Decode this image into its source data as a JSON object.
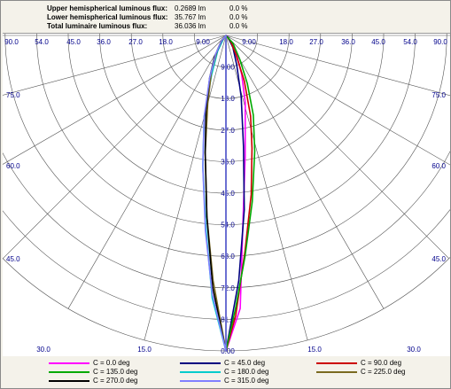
{
  "header": {
    "rows": [
      {
        "label": "Upper hemispherical luminous flux:",
        "value": "0.2689 lm",
        "pct": "0.0 %"
      },
      {
        "label": "Lower hemispherical luminous flux:",
        "value": "35.767 lm",
        "pct": "0.0 %"
      },
      {
        "label": "Total luminaire luminous flux:",
        "value": "36.036 lm",
        "pct": "0.0 %"
      }
    ]
  },
  "chart_data": {
    "type": "polar-candela",
    "title": "",
    "top_ticks": [
      "90.0",
      "54.0",
      "45.0",
      "36.0",
      "27.0",
      "18.0",
      "9.00",
      "9.00",
      "18.0",
      "27.0",
      "36.0",
      "45.0",
      "54.0",
      "90.0"
    ],
    "radial_ticks": [
      "9.00",
      "18.0",
      "27.0",
      "36.0",
      "45.0",
      "54.0",
      "63.0",
      "72.0",
      "81.0",
      "0.00"
    ],
    "angle_labels": [
      {
        "side": "left",
        "text": "75.0"
      },
      {
        "side": "left",
        "text": "60.0"
      },
      {
        "side": "left",
        "text": "45.0"
      },
      {
        "side": "right",
        "text": "75.0"
      },
      {
        "side": "right",
        "text": "60.0"
      },
      {
        "side": "right",
        "text": "45.0"
      }
    ],
    "bottom_labels": [
      {
        "side": "left",
        "text": "30.0"
      },
      {
        "side": "left",
        "text": "15.0"
      },
      {
        "side": "right",
        "text": "15.0"
      },
      {
        "side": "right",
        "text": "30.0"
      }
    ],
    "r_max": 90,
    "series": [
      {
        "name": "C = 0.0 deg",
        "color": "#ff00ff",
        "points": [
          [
            0,
            90
          ],
          [
            3,
            78
          ],
          [
            5,
            55
          ],
          [
            9,
            35
          ],
          [
            16,
            20
          ],
          [
            22,
            12
          ],
          [
            30,
            6
          ],
          [
            40,
            2
          ],
          [
            60,
            0.5
          ],
          [
            90,
            0
          ]
        ]
      },
      {
        "name": "C = 45.0 deg",
        "color": "#000080",
        "points": [
          [
            0,
            90
          ],
          [
            3,
            70
          ],
          [
            6,
            50
          ],
          [
            9,
            32
          ],
          [
            14,
            18
          ],
          [
            20,
            9
          ],
          [
            30,
            4
          ],
          [
            45,
            1
          ],
          [
            90,
            0
          ]
        ]
      },
      {
        "name": "C = 90.0 deg",
        "color": "#cc0000",
        "points": [
          [
            0,
            90
          ],
          [
            2,
            80
          ],
          [
            5,
            62
          ],
          [
            9,
            46
          ],
          [
            13,
            33
          ],
          [
            17,
            24
          ],
          [
            22,
            14
          ],
          [
            28,
            6
          ],
          [
            40,
            2
          ],
          [
            90,
            0
          ]
        ]
      },
      {
        "name": "C = 135.0 deg",
        "color": "#00aa00",
        "points": [
          [
            0,
            90
          ],
          [
            2,
            78
          ],
          [
            5,
            63
          ],
          [
            9,
            48
          ],
          [
            14,
            34
          ],
          [
            19,
            24
          ],
          [
            24,
            15
          ],
          [
            30,
            8
          ],
          [
            42,
            3
          ],
          [
            90,
            0
          ]
        ]
      },
      {
        "name": "C = 180.0 deg",
        "color": "#00cccc",
        "points": [
          [
            0,
            90
          ],
          [
            3,
            75
          ],
          [
            6,
            55
          ],
          [
            10,
            38
          ],
          [
            15,
            24
          ],
          [
            20,
            12
          ],
          [
            28,
            5
          ],
          [
            40,
            1
          ],
          [
            90,
            0
          ]
        ]
      },
      {
        "name": "C = 225.0 deg",
        "color": "#7a6a20",
        "points": [
          [
            0,
            90
          ],
          [
            3,
            70
          ],
          [
            6,
            52
          ],
          [
            10,
            34
          ],
          [
            15,
            20
          ],
          [
            22,
            11
          ],
          [
            30,
            5
          ],
          [
            42,
            2
          ],
          [
            90,
            0
          ]
        ]
      },
      {
        "name": "C = 270.0 deg",
        "color": "#000000",
        "points": [
          [
            0,
            90
          ],
          [
            3,
            72
          ],
          [
            6,
            52
          ],
          [
            10,
            34
          ],
          [
            15,
            22
          ],
          [
            21,
            13
          ],
          [
            28,
            7
          ],
          [
            38,
            2
          ],
          [
            90,
            0
          ]
        ]
      },
      {
        "name": "C = 315.0 deg",
        "color": "#8080ff",
        "points": [
          [
            0,
            90
          ],
          [
            3,
            74
          ],
          [
            6,
            56
          ],
          [
            10,
            38
          ],
          [
            15,
            24
          ],
          [
            21,
            13
          ],
          [
            29,
            6
          ],
          [
            40,
            2
          ],
          [
            90,
            0
          ]
        ]
      }
    ]
  }
}
